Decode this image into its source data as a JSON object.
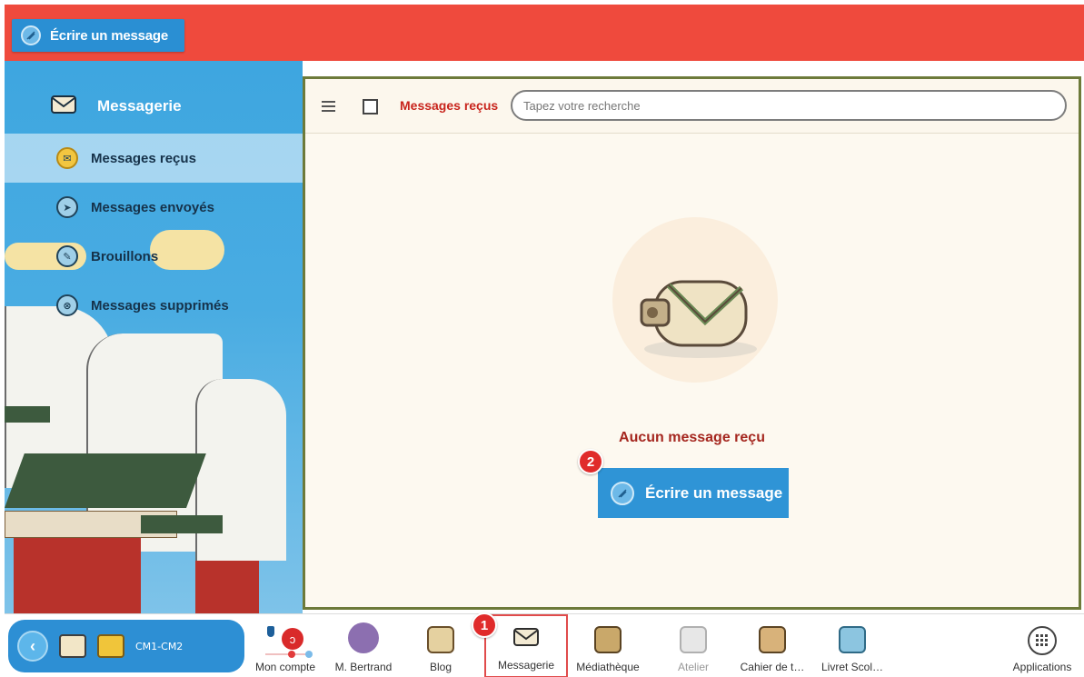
{
  "colors": {
    "banner_red": "#ef4a3d",
    "accent_blue": "#2a8fd3",
    "title_red": "#c8241c",
    "badge_red": "#e02b2b"
  },
  "topbar": {
    "write_button_label": "Écrire un message",
    "write_icon": "message-quill-icon"
  },
  "sidebar": {
    "header": {
      "label": "Messagerie",
      "icon": "envelope-icon"
    },
    "items": [
      {
        "label": "Messages reçus",
        "icon": "inbox-icon",
        "active": true
      },
      {
        "label": "Messages envoyés",
        "icon": "sent-icon",
        "active": false
      },
      {
        "label": "Brouillons",
        "icon": "drafts-icon",
        "active": false
      },
      {
        "label": "Messages supprimés",
        "icon": "trash-icon",
        "active": false
      }
    ]
  },
  "main": {
    "menu_icon": "hamburger-icon",
    "title": "Messages reçus",
    "search": {
      "placeholder": "Tapez votre recherche",
      "value": ""
    },
    "empty_state": {
      "illustration_icon": "envelope-scroll-icon",
      "text": "Aucun message reçu",
      "button_label": "Écrire un message"
    },
    "badge_write": "2"
  },
  "bottombar": {
    "class_label": "CM1-CM2",
    "apps": [
      {
        "label": "Mon compte",
        "icon": "account-icon"
      },
      {
        "label": "M. Bertrand",
        "icon": "avatar-icon"
      },
      {
        "label": "Blog",
        "icon": "blog-icon"
      },
      {
        "label": "Messagerie",
        "icon": "envelope-icon",
        "selected": true
      },
      {
        "label": "Médiathèque",
        "icon": "media-icon"
      },
      {
        "label": "Atelier",
        "icon": "workshop-icon",
        "dim": true
      },
      {
        "label": "Cahier de t…",
        "icon": "notebook-icon"
      },
      {
        "label": "Livret Scol…",
        "icon": "booklet-icon"
      },
      {
        "label": "Applications",
        "icon": "grid-icon"
      }
    ],
    "badge_messagerie": "1"
  }
}
